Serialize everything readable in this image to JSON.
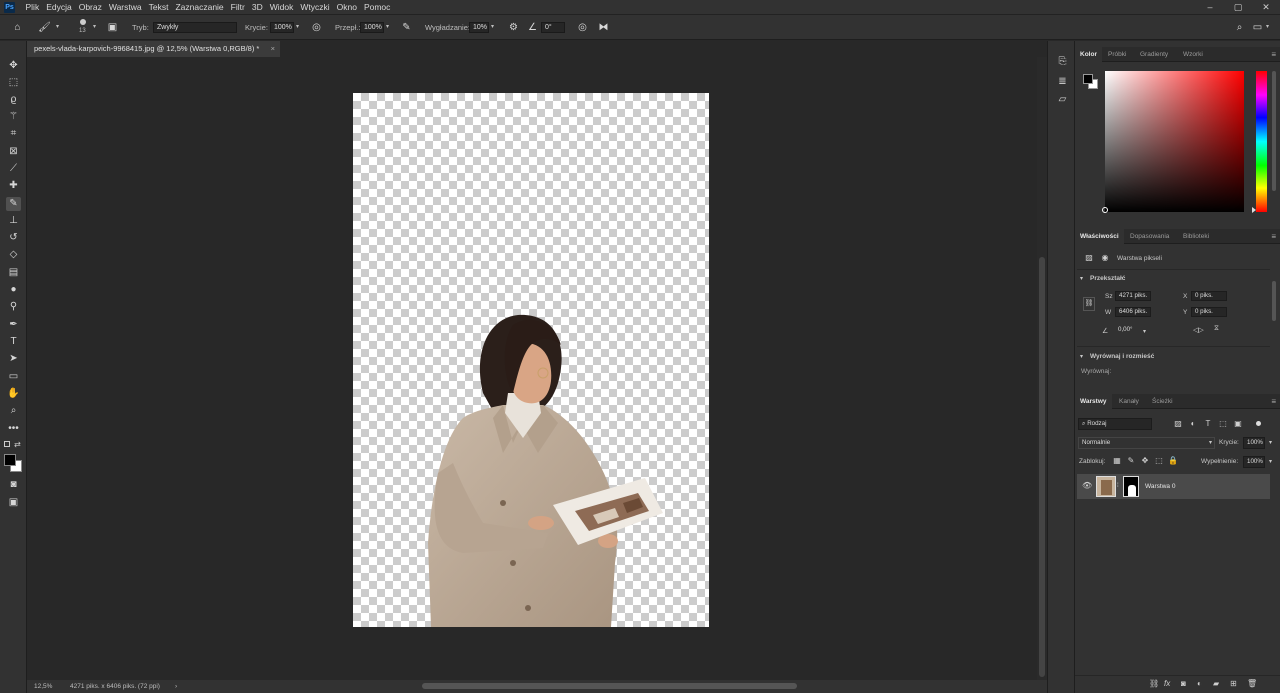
{
  "app": {
    "logo": "Ps"
  },
  "menu": [
    "Plik",
    "Edycja",
    "Obraz",
    "Warstwa",
    "Tekst",
    "Zaznaczanie",
    "Filtr",
    "3D",
    "Widok",
    "Wtyczki",
    "Okno",
    "Pomoc"
  ],
  "window_controls": {
    "minimize": "–",
    "maximize": "▢",
    "close": "✕"
  },
  "options": {
    "brush_size": "13",
    "mode_label": "Tryb:",
    "mode_value": "Zwykły",
    "opacity_label": "Krycie:",
    "opacity_value": "100%",
    "flow_label": "Przepł.:",
    "flow_value": "100%",
    "smoothing_label": "Wygładzanie:",
    "smoothing_value": "10%",
    "angle_value": "0°"
  },
  "document_tab": {
    "title": "pexels-vlada-karpovich-9968415.jpg @ 12,5% (Warstwa 0,RGB/8) *",
    "close": "×"
  },
  "status": {
    "zoom": "12,5%",
    "info": "4271 piks. x 6406 piks. (72 ppi)",
    "arrow": "›"
  },
  "color_panel": {
    "tabs": [
      "Kolor",
      "Próbki",
      "Gradienty",
      "Wzorki"
    ],
    "active": 0
  },
  "properties_panel": {
    "tabs": [
      "Właściwości",
      "Dopasowania",
      "Biblioteki"
    ],
    "layer_type": "Warstwa pikseli",
    "transform_heading": "Przekształć",
    "w_label": "Sz",
    "w_value": "4271 piks.",
    "h_label": "W",
    "h_value": "6406 piks.",
    "x_label": "X",
    "x_value": "0 piks.",
    "y_label": "Y",
    "y_value": "0 piks.",
    "angle_value": "0,00°",
    "align_heading": "Wyrównaj i rozmieść",
    "align_label": "Wyrównaj:"
  },
  "layers_panel": {
    "tabs": [
      "Warstwy",
      "Kanały",
      "Ścieżki"
    ],
    "filter_value": "Rodzaj",
    "blend_mode": "Normalnie",
    "opacity_label": "Krycie:",
    "opacity_value": "100%",
    "lock_label": "Zablokuj:",
    "fill_label": "Wypełnienie:",
    "fill_value": "100%",
    "layers": [
      {
        "name": "Warstwa 0",
        "visible": true
      }
    ]
  }
}
